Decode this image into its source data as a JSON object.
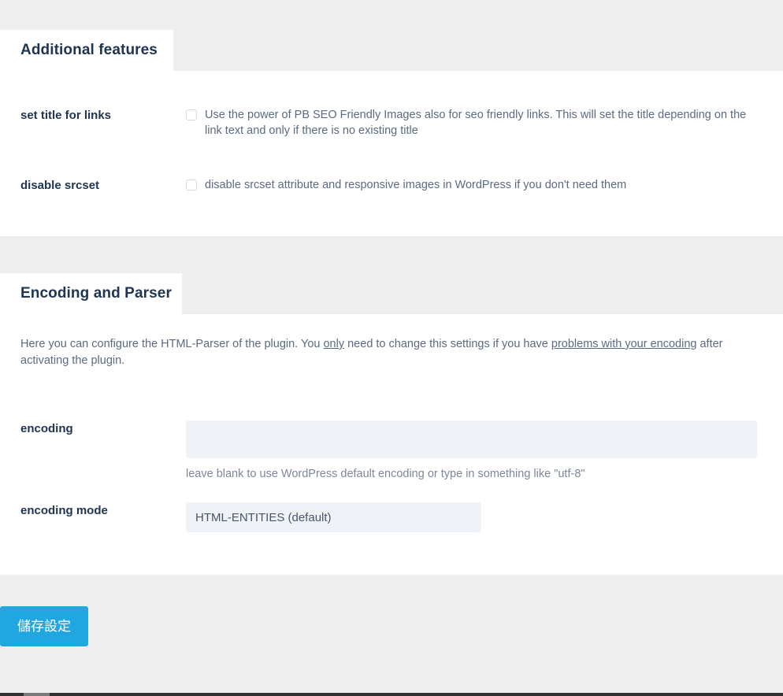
{
  "sections": [
    {
      "tab_title": "Additional features",
      "tab_width": 220,
      "rows": [
        {
          "label": "set title for links",
          "description": "Use the power of PB SEO Friendly Images also for seo friendly links. This will set the title depending on the link text and only if there is no existing title",
          "checked": false
        },
        {
          "label": "disable srcset",
          "description": "disable srcset attribute and responsive images in WordPress if you don't need them",
          "checked": false
        }
      ]
    },
    {
      "tab_title": "Encoding and Parser",
      "tab_width": 231,
      "intro": {
        "part1": "Here you can configure the HTML-Parser of the plugin. You ",
        "underline1": "only",
        "part2": " need to change this settings if you have ",
        "underline2": "problems with your encoding",
        "part3": " after activating the plugin."
      },
      "encoding_field": {
        "label": "encoding",
        "value": "",
        "placeholder": "",
        "hint": "leave blank to use WordPress default encoding or type in something like \"utf-8\""
      },
      "encoding_mode_field": {
        "label": "encoding mode",
        "selected": "HTML-ENTITIES (default)"
      }
    }
  ],
  "footer": {
    "save_label": "儲存設定"
  },
  "colors": {
    "page_background": "#eeeeee",
    "panel_background": "#ffffff",
    "heading": "#20354f",
    "body_text": "#5a6b80",
    "input_background": "#eff2f7",
    "accent_button": "#21a7e0"
  }
}
